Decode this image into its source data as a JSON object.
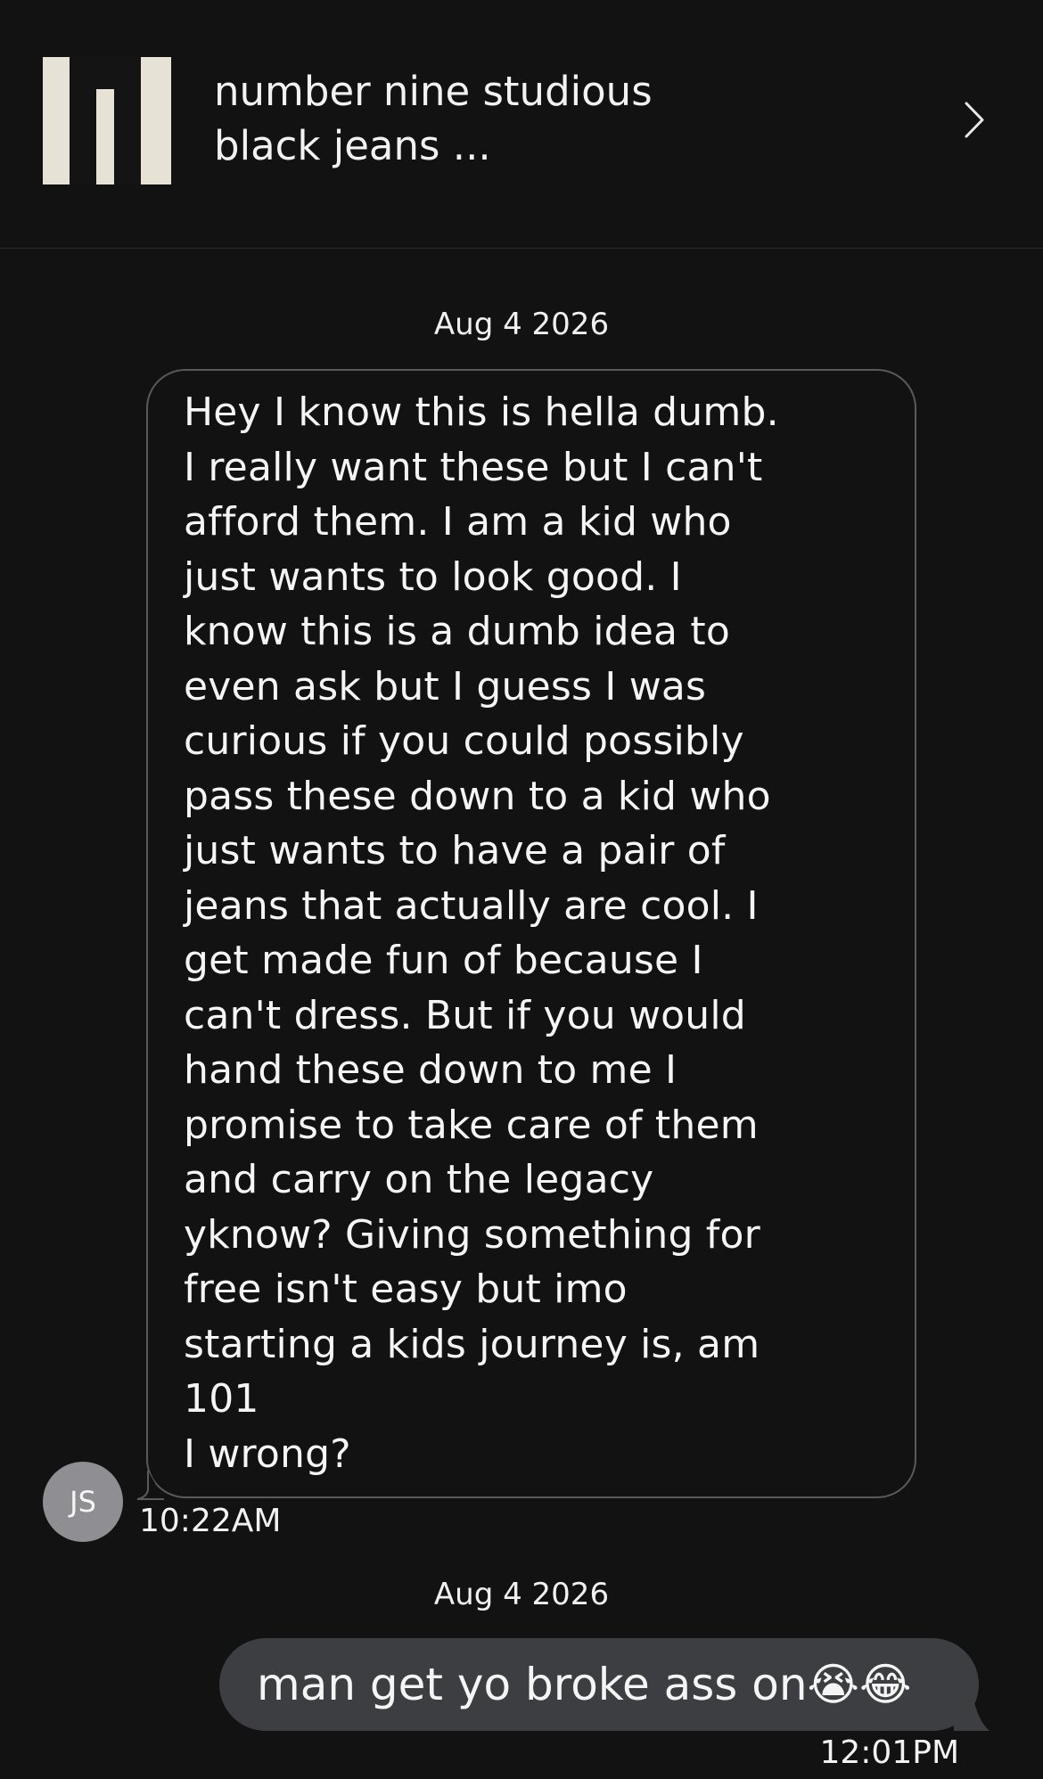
{
  "header": {
    "thumbnail_icon": "black-jeans-product-image",
    "title": "number nine studious black jeans ...",
    "chevron_icon": "chevron-right-icon"
  },
  "conversation": {
    "date_1": "Aug 4 2026",
    "incoming": {
      "avatar_initials": "JS",
      "text": "Hey I know this is hella dumb.\nI really want these but I can't\nafford them. I am a kid who\njust wants to look good. I\nknow this is a dumb idea to\neven ask but I guess I was\ncurious if you could possibly\npass these down to a kid who\njust wants to have a pair of\njeans that actually are cool. I\nget made fun of because I\ncan't dress. But if you would\nhand these down to me I\npromise to take care of them\nand carry on the legacy\nyknow? Giving something for\nfree isn't easy but imo\nstarting a kids journey is, am\n101\nI wrong?",
      "time": "10:22AM"
    },
    "date_2": "Aug 4 2026",
    "outgoing": {
      "text": "man get yo broke ass on😭😂",
      "time": "12:01PM"
    }
  },
  "colors": {
    "background": "#121212",
    "outgoing_bubble": "#3d3e41",
    "incoming_border": "#5a5a5a",
    "avatar": "#8f8f93"
  }
}
